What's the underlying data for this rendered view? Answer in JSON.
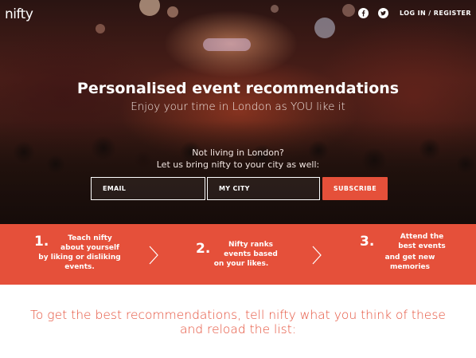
{
  "header": {
    "logo": "nifty",
    "login_label": "LOG IN / REGISTER"
  },
  "hero": {
    "title": "Personalised event recommendations",
    "subtitle": "Enjoy your time in London as YOU like it",
    "note_line1": "Not living in London?",
    "note_line2": "Let us bring nifty to your city as well:"
  },
  "form": {
    "email_placeholder": "EMAIL",
    "city_placeholder": "MY CITY",
    "subscribe_label": "SUBSCRIBE"
  },
  "steps": [
    {
      "number": "1.",
      "lines": [
        "Teach nifty",
        "about yourself",
        "by liking or disliking",
        "events."
      ]
    },
    {
      "number": "2.",
      "lines": [
        "Nifty ranks",
        "events based",
        "on your likes."
      ]
    },
    {
      "number": "3.",
      "lines": [
        "Attend the",
        "best events",
        "and get new",
        "memories"
      ]
    }
  ],
  "recommend": {
    "line1": "To get the best recommendations, tell nifty what you think of these",
    "line2": "and reload the list:"
  },
  "colors": {
    "accent": "#e5503a",
    "white": "#ffffff"
  },
  "icons": [
    "facebook-icon",
    "twitter-icon",
    "chevron-right-icon"
  ]
}
